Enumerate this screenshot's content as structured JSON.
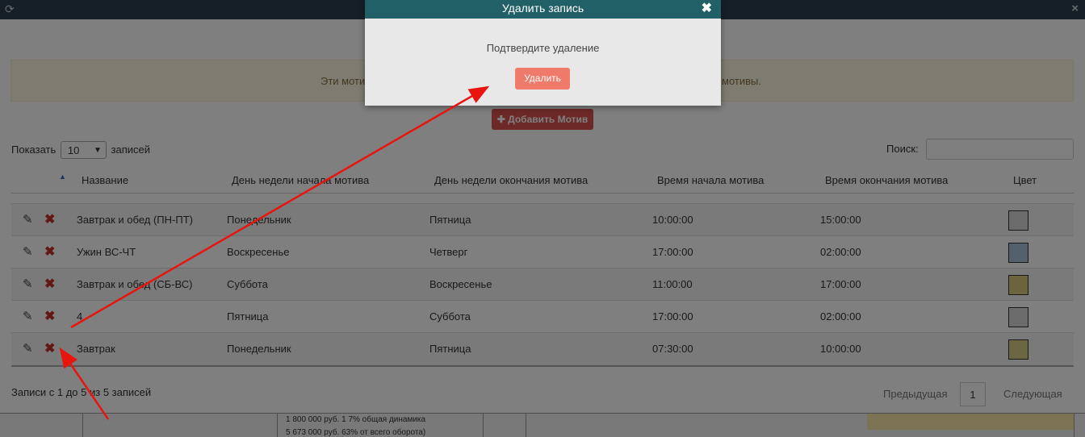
{
  "topbar": {
    "refresh_icon": "refresh-icon",
    "close_icon": "close-icon"
  },
  "info_banner": {
    "left_text": "Эти моти",
    "right_text": "мотивы."
  },
  "add_button": {
    "label": "✚ Добавить Мотив"
  },
  "length_control": {
    "prefix": "Показать",
    "value": "10",
    "suffix": "записей"
  },
  "search": {
    "label": "Поиск:",
    "value": ""
  },
  "table": {
    "columns": [
      "Название",
      "День недели начала мотива",
      "День недели окончания мотива",
      "Время начала мотива",
      "Время окончания мотива",
      "Цвет"
    ],
    "rows": [
      {
        "name": "Завтрак и обед (ПН-ПТ)",
        "start_day": "Понедельник",
        "end_day": "Пятница",
        "start_time": "10:00:00",
        "end_time": "15:00:00",
        "color": "#d8d8d8"
      },
      {
        "name": "Ужин ВС-ЧТ",
        "start_day": "Воскресенье",
        "end_day": "Четверг",
        "start_time": "17:00:00",
        "end_time": "02:00:00",
        "color": "#a9c2d8"
      },
      {
        "name": "Завтрак и обед (СБ-ВС)",
        "start_day": "Суббота",
        "end_day": "Воскресенье",
        "start_time": "11:00:00",
        "end_time": "17:00:00",
        "color": "#d7c97a"
      },
      {
        "name": "4",
        "start_day": "Пятница",
        "end_day": "Суббота",
        "start_time": "17:00:00",
        "end_time": "02:00:00",
        "color": "#d8d8d8"
      },
      {
        "name": "Завтрак",
        "start_day": "Понедельник",
        "end_day": "Пятница",
        "start_time": "07:30:00",
        "end_time": "10:00:00",
        "color": "#d9cc85"
      }
    ]
  },
  "footer": {
    "info": "Записи с 1 до 5 из 5 записей",
    "prev": "Предыдущая",
    "page": "1",
    "next": "Следующая"
  },
  "bottom_strip": {
    "line1": "1 800 000 руб. 1 7% общая динамика",
    "line2": "5 673 000 руб. 63% от всего оборота)"
  },
  "modal": {
    "title": "Удалить запись",
    "message": "Подтвердите удаление",
    "delete_label": "Удалить"
  },
  "colors": {
    "modal_header": "#216066",
    "delete_button": "#ef7a6a",
    "add_button": "#d9534f",
    "arrow": "#e8140e"
  }
}
